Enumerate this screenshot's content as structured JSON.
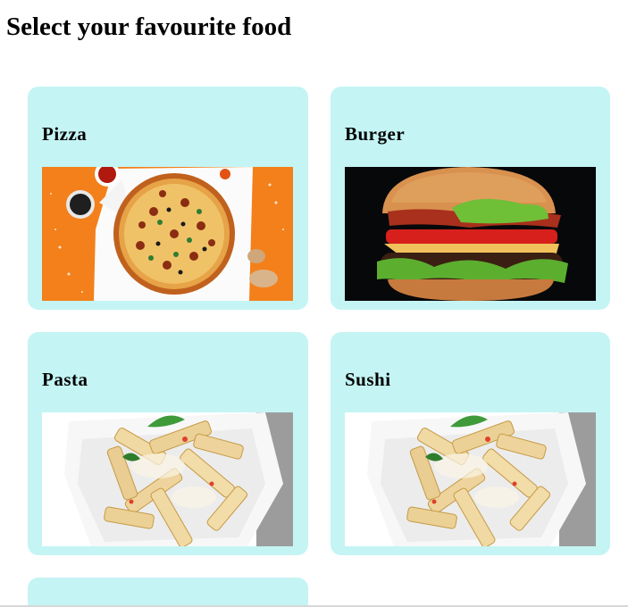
{
  "page": {
    "title": "Select your favourite food"
  },
  "foods": [
    {
      "name": "Pizza",
      "image": "pizza-photo"
    },
    {
      "name": "Burger",
      "image": "burger-photo"
    },
    {
      "name": "Pasta",
      "image": "pasta-photo"
    },
    {
      "name": "Sushi",
      "image": "pasta-photo"
    }
  ],
  "colors": {
    "card_background": "#c4f4f4",
    "pizza_backdrop": "#f47b15",
    "burger_backdrop": "#07080a",
    "pasta_backdrop": "#ffffff"
  }
}
